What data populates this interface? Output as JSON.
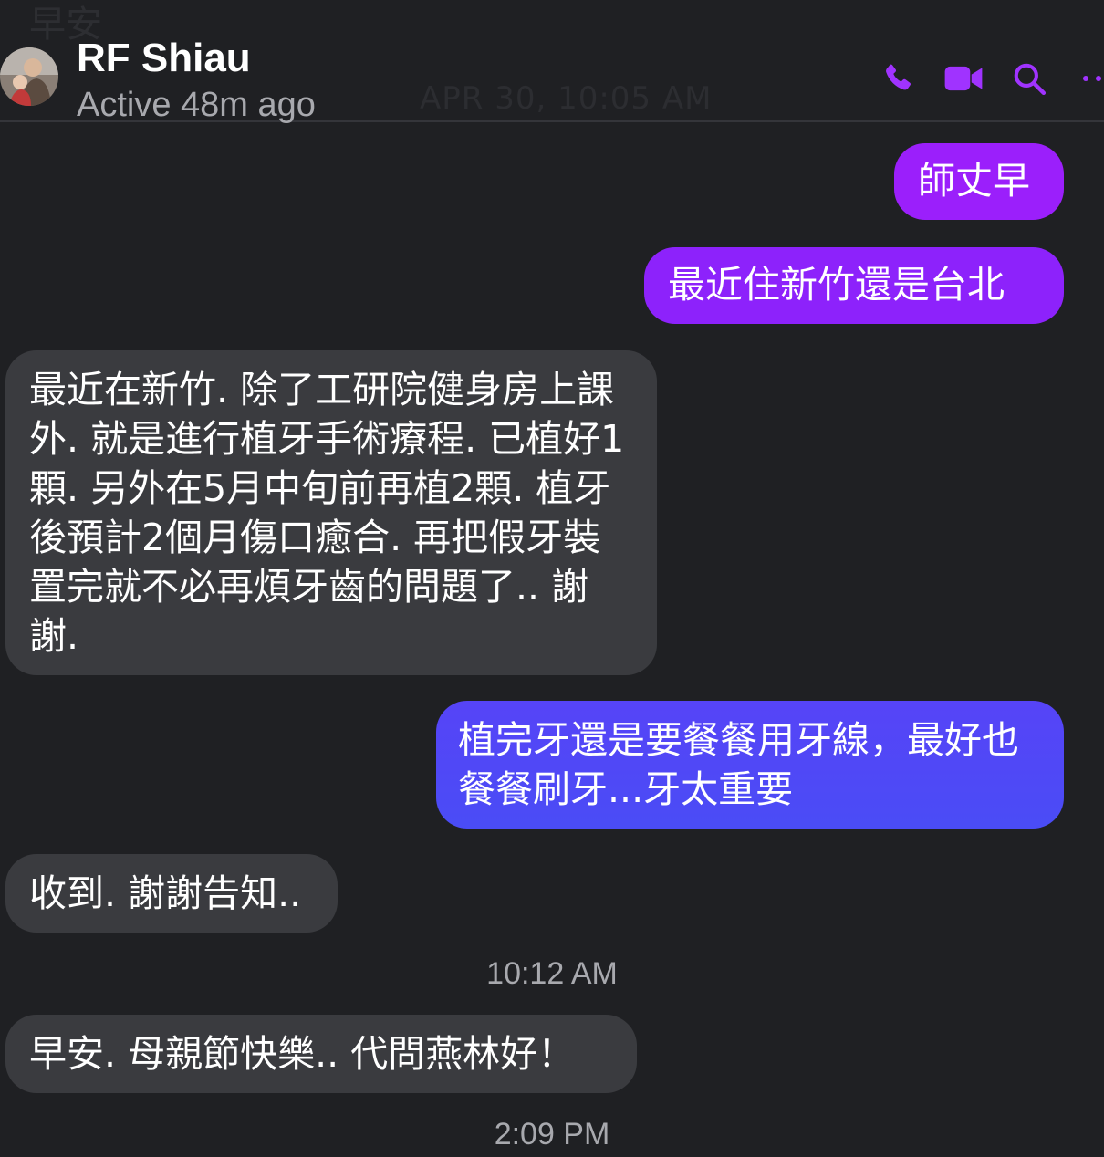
{
  "background_ghost": {
    "top_text": "早安",
    "date_text": "APR 30, 10:05 AM"
  },
  "header": {
    "contact_name": "RF Shiau",
    "status": "Active 48m ago",
    "icons": [
      "phone-icon",
      "video-camera-icon",
      "search-icon",
      "more-icon"
    ],
    "accent_color": "#a033ff"
  },
  "messages": [
    {
      "direction": "out",
      "text": "師丈早"
    },
    {
      "direction": "out",
      "text": "最近住新竹還是台北"
    },
    {
      "direction": "in",
      "text": "最近在新竹. 除了工研院健身房上課外. 就是進行植牙手術療程. 已植好1顆. 另外在5月中旬前再植2顆. 植牙後預計2個月傷口癒合. 再把假牙裝置完就不必再煩牙齒的問題了.. 謝謝."
    },
    {
      "direction": "out",
      "text": "植完牙還是要餐餐用牙線，最好也餐餐刷牙...牙太重要"
    },
    {
      "direction": "in",
      "text": "收到. 謝謝告知.."
    },
    {
      "direction": "in",
      "text": "早安. 母親節快樂.. 代問燕林好！"
    }
  ],
  "timestamps": [
    "10:12 AM",
    "2:09 PM"
  ],
  "colors": {
    "background": "#1f2023",
    "incoming_bubble": "#3a3b3f",
    "outgoing_gradient_top": "#a01dfb",
    "outgoing_gradient_bottom": "#4a4cf6"
  }
}
